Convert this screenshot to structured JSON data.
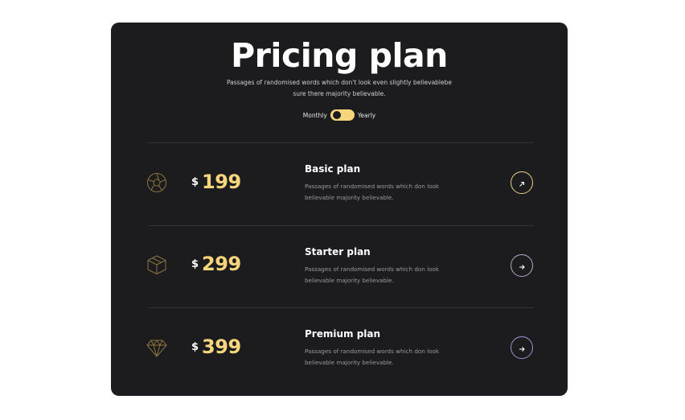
{
  "header": {
    "title": "Pricing plan",
    "subtitle_line1": "Passages of randomised words which don't look even slightly believablebe",
    "subtitle_line2": "sure there majority believable."
  },
  "billing_toggle": {
    "left_label": "Monthly",
    "right_label": "Yearly",
    "active": "Monthly"
  },
  "plans": [
    {
      "icon": "aperture-icon",
      "currency": "$",
      "price": "199",
      "name": "Basic plan",
      "desc_line1": "Passages of randomised words which don look",
      "desc_line2": "believable majority believable.",
      "action_icon": "arrow-up-right-icon"
    },
    {
      "icon": "box-icon",
      "currency": "$",
      "price": "299",
      "name": "Starter plan",
      "desc_line1": "Passages of randomised words which don look",
      "desc_line2": "believable majority believable.",
      "action_icon": "arrow-right-icon"
    },
    {
      "icon": "diamond-icon",
      "currency": "$",
      "price": "399",
      "name": "Premium plan",
      "desc_line1": "Passages of randomised words which don look",
      "desc_line2": "believable majority believable.",
      "action_icon": "arrow-right-icon"
    }
  ],
  "colors": {
    "card_background": "#1c1c1e",
    "accent": "#f6d57d",
    "text_primary": "#ffffff",
    "text_muted": "#9a9a9c",
    "divider": "#343436"
  }
}
